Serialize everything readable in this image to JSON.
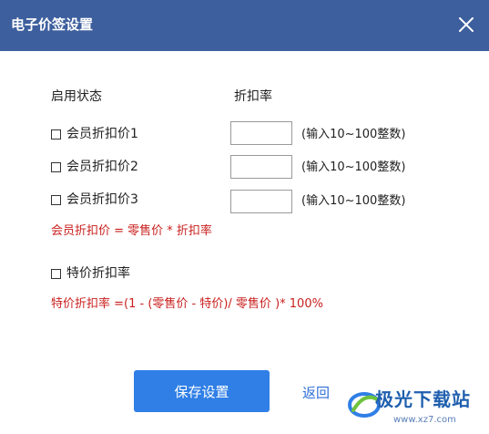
{
  "window": {
    "title": "电子价签设置"
  },
  "headers": {
    "status": "启用状态",
    "discount_rate": "折扣率"
  },
  "members": [
    {
      "label": "会员折扣价1",
      "value": "",
      "hint": "(输入10~100整数)"
    },
    {
      "label": "会员折扣价2",
      "value": "",
      "hint": "(输入10~100整数)"
    },
    {
      "label": "会员折扣价3",
      "value": "",
      "hint": "(输入10~100整数)"
    }
  ],
  "formula_member": "会员折扣价 = 零售价 * 折扣率",
  "special": {
    "label": "特价折扣率"
  },
  "formula_special": "特价折扣率 =(1 - (零售价 - 特价)/  零售价 )* 100%",
  "buttons": {
    "save": "保存设置",
    "back": "返回"
  },
  "watermark": {
    "name": "极光下载站",
    "url": "www.xz7.com"
  },
  "colors": {
    "titlebar": "#3d5f9e",
    "primary": "#2f7fe6",
    "formula": "#c8201e",
    "link": "#2f6fd6"
  }
}
